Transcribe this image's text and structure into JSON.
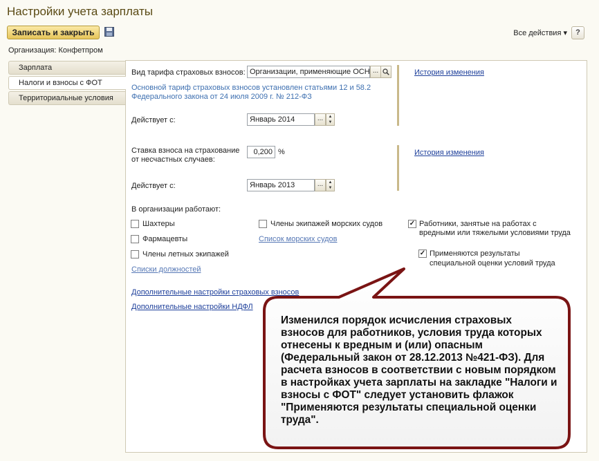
{
  "window": {
    "title": "Настройки учета зарплаты"
  },
  "toolbar": {
    "save_close_label": "Записать и закрыть",
    "all_actions_label": "Все действия ▾",
    "help_label": "?"
  },
  "organization": {
    "label": "Организация:",
    "value": "Конфетпром"
  },
  "tabs": [
    {
      "label": "Зарплата"
    },
    {
      "label": "Налоги и взносы с ФОТ"
    },
    {
      "label": "Территориальные условия"
    }
  ],
  "tariff": {
    "label": "Вид тарифа страховых взносов:",
    "value": "Организации, применяющие ОСН",
    "note": "Основной тариф страховых взносов установлен статьями 12 и 58.2 Федерального закона от 24 июля 2009 г. № 212-ФЗ",
    "history_link": "История изменения",
    "effective_label": "Действует с:",
    "effective_value": "Январь 2014"
  },
  "accident": {
    "label_line1": "Ставка взноса на страхование",
    "label_line2": "от несчастных случаев:",
    "rate_value": "0,200",
    "percent": "%",
    "history_link": "История изменения",
    "effective_label": "Действует с:",
    "effective_value": "Январь 2013"
  },
  "workers": {
    "heading": "В организации работают:",
    "miners": {
      "label": "Шахтеры",
      "checked": false
    },
    "pharmacists": {
      "label": "Фармацевты",
      "checked": false
    },
    "flight_crews": {
      "label": "Члены летных экипажей",
      "checked": false
    },
    "positions_link": "Списки должностей",
    "sea_crews": {
      "label": "Члены экипажей морских судов",
      "checked": false
    },
    "sea_vessels_link": "Список морских судов",
    "hazardous": {
      "line1": "Работники, занятые на работах с",
      "line2": "вредными или тяжелыми условиями труда",
      "checked": true
    },
    "special_assessment": {
      "line1": "Применяются результаты",
      "line2": "специальной оценки условий труда",
      "checked": true
    }
  },
  "links": {
    "extra_insurance": "Дополнительные настройки страховых взносов",
    "extra_ndfl": "Дополнительные настройки НДФЛ"
  },
  "callout": {
    "text": "Изменился порядок исчисления страховых взносов для работников, условия труда которых отнесены к вредным и (или) опасным (Федеральный закон от 28.12.2013 №421-ФЗ). Для расчета взносов в соответствии с новым порядком в настройках учета зарплаты на закладке \"Налоги и взносы с ФОТ\" следует установить флажок \"Применяются результаты специальной оценки труда\"."
  },
  "colors": {
    "accent_gold": "#e6c55a",
    "callout_border": "#7a1414",
    "link_blue": "#1c3e9a"
  }
}
